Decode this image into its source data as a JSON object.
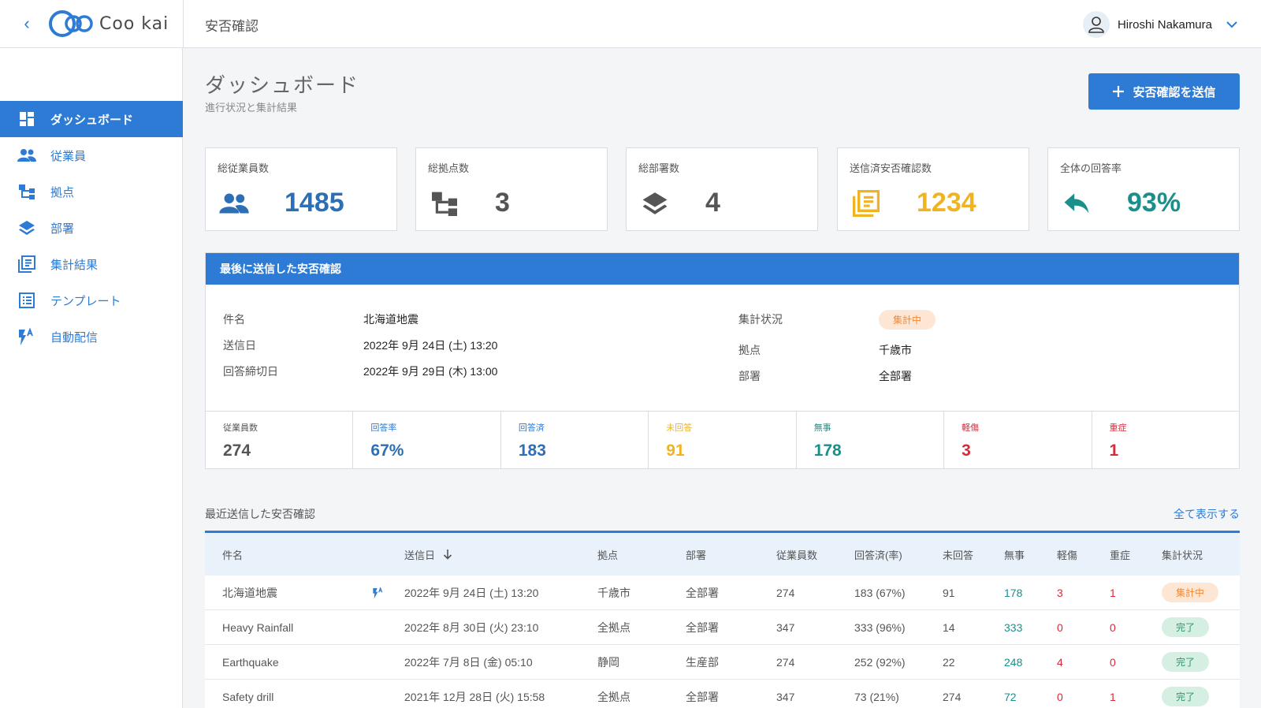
{
  "header": {
    "back_label": "‹",
    "logo_text": "Coo kai",
    "title": "安否確認",
    "user_name": "Hiroshi Nakamura"
  },
  "sidebar": {
    "items": [
      {
        "label": "ダッシュボード",
        "icon": "dashboard-icon"
      },
      {
        "label": "従業員",
        "icon": "people-icon"
      },
      {
        "label": "拠点",
        "icon": "sitemap-icon"
      },
      {
        "label": "部署",
        "icon": "layers-icon"
      },
      {
        "label": "集計結果",
        "icon": "report-icon"
      },
      {
        "label": "テンプレート",
        "icon": "list-icon"
      },
      {
        "label": "自動配信",
        "icon": "auto-send-icon"
      }
    ]
  },
  "page": {
    "title": "ダッシュボード",
    "subtitle": "進行状況と集計結果",
    "send_button": "安否確認を送信"
  },
  "stats": [
    {
      "label": "総従業員数",
      "value": "1485",
      "color": "#2d6fb5",
      "icon": "people-icon"
    },
    {
      "label": "総拠点数",
      "value": "3",
      "color": "#555555",
      "icon": "sitemap-icon"
    },
    {
      "label": "総部署数",
      "value": "4",
      "color": "#555555",
      "icon": "layers-icon"
    },
    {
      "label": "送信済安否確認数",
      "value": "1234",
      "color": "#f0b322",
      "icon": "report-icon"
    },
    {
      "label": "全体の回答率",
      "value": "93%",
      "color": "#1b8f8a",
      "icon": "reply-icon"
    }
  ],
  "latest": {
    "heading": "最後に送信した安否確認",
    "subject_label": "件名",
    "subject": "北海道地震",
    "sent_label": "送信日",
    "sent": "2022年 9月 24日 (土) 13:20",
    "deadline_label": "回答締切日",
    "deadline": "2022年 9月 29日 (木) 13:00",
    "status_label": "集計状況",
    "status": "集計中",
    "site_label": "拠点",
    "site": "千歳市",
    "dept_label": "部署",
    "dept": "全部署",
    "metrics": [
      {
        "label": "従業員数",
        "value": "274",
        "label_color": "#555555",
        "value_color": "#555555"
      },
      {
        "label": "回答率",
        "value": "67%",
        "label_color": "#2d7bd4",
        "value_color": "#2d6fb5"
      },
      {
        "label": "回答済",
        "value": "183",
        "label_color": "#2d7bd4",
        "value_color": "#2d6fb5"
      },
      {
        "label": "未回答",
        "value": "91",
        "label_color": "#f0b322",
        "value_color": "#f0b322"
      },
      {
        "label": "無事",
        "value": "178",
        "label_color": "#1b8f8a",
        "value_color": "#1b8f8a"
      },
      {
        "label": "軽傷",
        "value": "3",
        "label_color": "#d62b3a",
        "value_color": "#d62b3a"
      },
      {
        "label": "重症",
        "value": "1",
        "label_color": "#d62b3a",
        "value_color": "#d62b3a"
      }
    ]
  },
  "recent": {
    "title": "最近送信した安否確認",
    "show_all": "全て表示する",
    "columns": [
      "件名",
      "送信日",
      "拠点",
      "部署",
      "従業員数",
      "回答済(率)",
      "未回答",
      "無事",
      "軽傷",
      "重症",
      "集計状況"
    ],
    "rows": [
      {
        "subject": "北海道地震",
        "auto": true,
        "sent": "2022年 9月 24日 (土) 13:20",
        "site": "千歳市",
        "dept": "全部署",
        "employees": "274",
        "answered": "183 (67%)",
        "unanswered": "91",
        "safe": "178",
        "minor": "3",
        "severe": "1",
        "status": "集計中",
        "status_type": "orange"
      },
      {
        "subject": "Heavy Rainfall",
        "auto": false,
        "sent": "2022年 8月 30日 (火) 23:10",
        "site": "全拠点",
        "dept": "全部署",
        "employees": "347",
        "answered": "333 (96%)",
        "unanswered": "14",
        "safe": "333",
        "minor": "0",
        "severe": "0",
        "status": "完了",
        "status_type": "green"
      },
      {
        "subject": "Earthquake",
        "auto": false,
        "sent": "2022年 7月 8日 (金) 05:10",
        "site": "静岡",
        "dept": "生産部",
        "employees": "274",
        "answered": "252 (92%)",
        "unanswered": "22",
        "safe": "248",
        "minor": "4",
        "severe": "0",
        "status": "完了",
        "status_type": "green"
      },
      {
        "subject": "Safety drill",
        "auto": false,
        "sent": "2021年 12月 28日 (火) 15:58",
        "site": "全拠点",
        "dept": "全部署",
        "employees": "347",
        "answered": "73 (21%)",
        "unanswered": "274",
        "safe": "72",
        "minor": "0",
        "severe": "1",
        "status": "完了",
        "status_type": "green"
      }
    ]
  }
}
